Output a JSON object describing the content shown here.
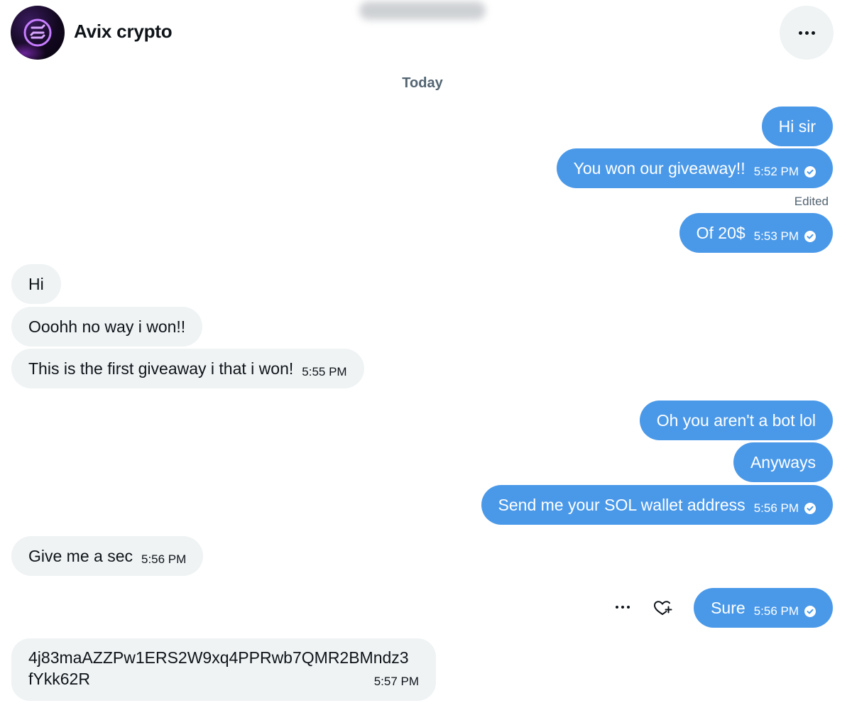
{
  "header": {
    "contact_name": "Avix crypto",
    "avatar_icon": "solana-logo-icon",
    "more_icon": "more-horizontal-icon"
  },
  "conversation": {
    "date_separator": "Today",
    "edited_label": "Edited",
    "messages": [
      {
        "direction": "out",
        "text": "Hi sir",
        "time": ""
      },
      {
        "direction": "out",
        "text": "You won our giveaway!!",
        "time": "5:52 PM",
        "status_icon": "sent-check-icon"
      },
      {
        "direction": "out",
        "text": "Of 20$",
        "time": "5:53 PM",
        "status_icon": "sent-check-icon",
        "edited": true
      },
      {
        "direction": "in",
        "text": "Hi",
        "time": ""
      },
      {
        "direction": "in",
        "text": "Ooohh no way i won!!",
        "time": ""
      },
      {
        "direction": "in",
        "text": "This is the first giveaway i that i won!",
        "time": "5:55 PM"
      },
      {
        "direction": "out",
        "text": "Oh you aren't a bot lol",
        "time": ""
      },
      {
        "direction": "out",
        "text": "Anyways",
        "time": ""
      },
      {
        "direction": "out",
        "text": "Send me your SOL wallet address",
        "time": "5:56 PM",
        "status_icon": "sent-check-icon"
      },
      {
        "direction": "in",
        "text": "Give me a sec",
        "time": "5:56 PM"
      },
      {
        "direction": "out",
        "text": "Sure",
        "time": "5:56 PM",
        "status_icon": "sent-check-icon"
      },
      {
        "direction": "in",
        "text": "4j83maAZZPw1ERS2W9xq4PPRwb7QMR2BMndz3fYkk62R",
        "time": "5:57 PM"
      }
    ]
  },
  "message_actions": {
    "more_icon": "more-horizontal-icon",
    "react_icon": "add-reaction-heart-icon"
  },
  "colors": {
    "outgoing_bubble": "#4a99e9",
    "incoming_bubble": "#eff3f4",
    "secondary_text": "#536471",
    "avatar_accent": "#9b4dff"
  }
}
